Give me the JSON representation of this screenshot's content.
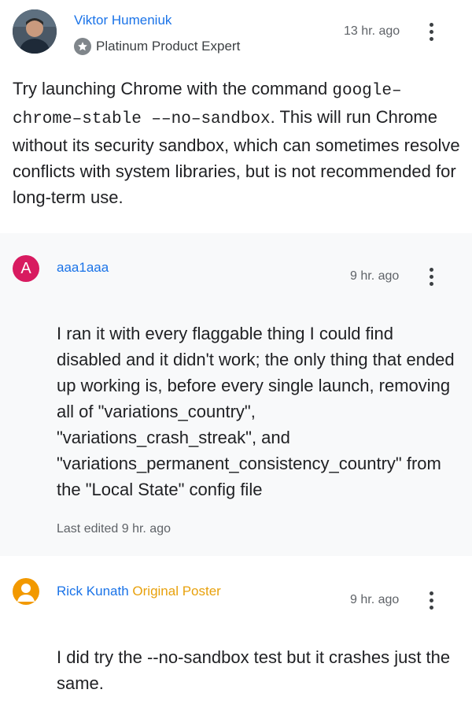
{
  "posts": [
    {
      "author": "Viktor Humeniuk",
      "badge": "Platinum Product Expert",
      "badge_icon": "star-badge-icon",
      "timestamp": "13 hr. ago",
      "body_before": " Try launching Chrome with the command ",
      "body_code_1": "google–",
      "body_code_2": "chrome–stable ––no–sandbox",
      "body_after": ". This will run Chrome without its security sandbox, which can sometimes resolve conflicts with system libraries, but is not recommended for long-term use."
    },
    {
      "author": "aaa1aaa",
      "avatar_letter": "A",
      "timestamp": "9 hr. ago",
      "body": "I ran it with every flaggable thing I could find disabled and it didn't work; the only thing that ended up working is, before every single launch, removing all of \"variations_country\", \"variations_crash_streak\", and \"variations_permanent_consistency_country\" from the \"Local State\" config file",
      "edited": "Last edited 9 hr. ago"
    },
    {
      "author": "Rick Kunath",
      "op_label": "Original Poster",
      "timestamp": "9 hr. ago",
      "body": "I did try the --no-sandbox test but it crashes just the same."
    }
  ],
  "colors": {
    "link": "#1a73e8",
    "op": "#e8a10c",
    "avatar_a": "#d81b60",
    "avatar_generic": "#f29900",
    "reply_bg": "#f8f9fa"
  }
}
